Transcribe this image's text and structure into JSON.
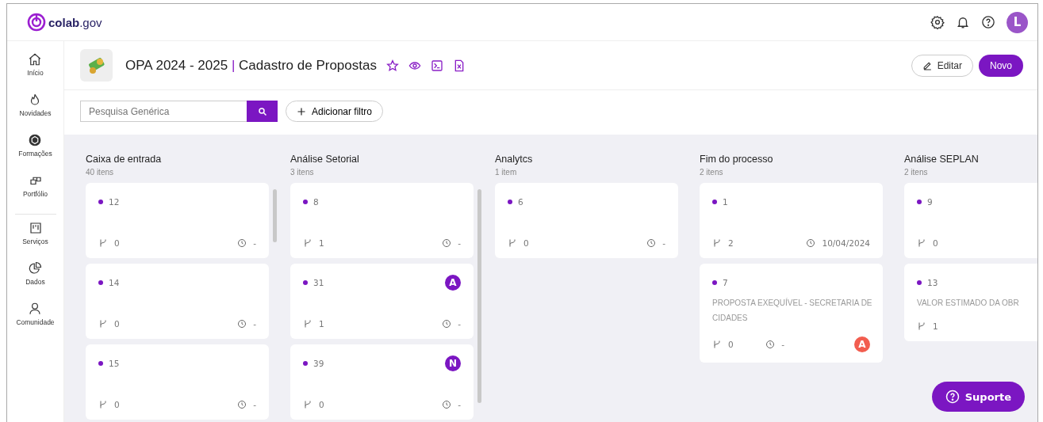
{
  "header": {
    "logo_text": "colab",
    "logo_suffix": ".gov",
    "avatar_initial": "L"
  },
  "sidebar": {
    "items": [
      {
        "label": "Início"
      },
      {
        "label": "Novidades"
      },
      {
        "label": "Formações"
      },
      {
        "label": "Portfólio"
      },
      {
        "label": "Serviços",
        "divider_before": true
      },
      {
        "label": "Dados"
      },
      {
        "label": "Comunidade"
      }
    ]
  },
  "page": {
    "title": "OPA 2024 - 2025",
    "separator": "|",
    "subtitle": "Cadastro de Propostas",
    "edit_button": "Editar",
    "new_button": "Novo"
  },
  "search": {
    "placeholder": "Pesquisa Genérica"
  },
  "filter_button": "Adicionar filtro",
  "columns": [
    {
      "title": "Caixa de entrada",
      "count": "40 itens",
      "scrollbar": true,
      "cards": [
        {
          "number": "12",
          "branches": "0",
          "date": "-"
        },
        {
          "number": "14",
          "branches": "0",
          "date": "-"
        },
        {
          "number": "15",
          "branches": "0",
          "date": "-"
        }
      ]
    },
    {
      "title": "Análise Setorial",
      "count": "3 itens",
      "scrollbar": true,
      "cards": [
        {
          "number": "8",
          "branches": "1",
          "date": "-"
        },
        {
          "number": "31",
          "branches": "1",
          "date": "-",
          "assignee": {
            "initial": "A",
            "color": "#7b16c2"
          }
        },
        {
          "number": "39",
          "branches": "0",
          "date": "-",
          "assignee": {
            "initial": "N",
            "color": "#7b16c2"
          }
        }
      ]
    },
    {
      "title": "Analytcs",
      "count": "1 item",
      "cards": [
        {
          "number": "6",
          "branches": "0",
          "date": "-"
        }
      ]
    },
    {
      "title": "Fim do processo",
      "count": "2 itens",
      "cards": [
        {
          "number": "1",
          "branches": "2",
          "date": "10/04/2024"
        },
        {
          "number": "7",
          "text": "PROPOSTA EXEQUÍVEL - SECRETARIA DE CIDADES",
          "branches": "0",
          "date": "-",
          "assignee": {
            "initial": "A",
            "color": "#f25d4f"
          }
        }
      ]
    },
    {
      "title": "Análise SEPLAN",
      "count": "2 itens",
      "cards": [
        {
          "number": "9",
          "branches": "0"
        },
        {
          "number": "13",
          "text": "VALOR ESTIMADO DA OBR",
          "branches": "1"
        }
      ]
    }
  ],
  "support_button": "Suporte"
}
